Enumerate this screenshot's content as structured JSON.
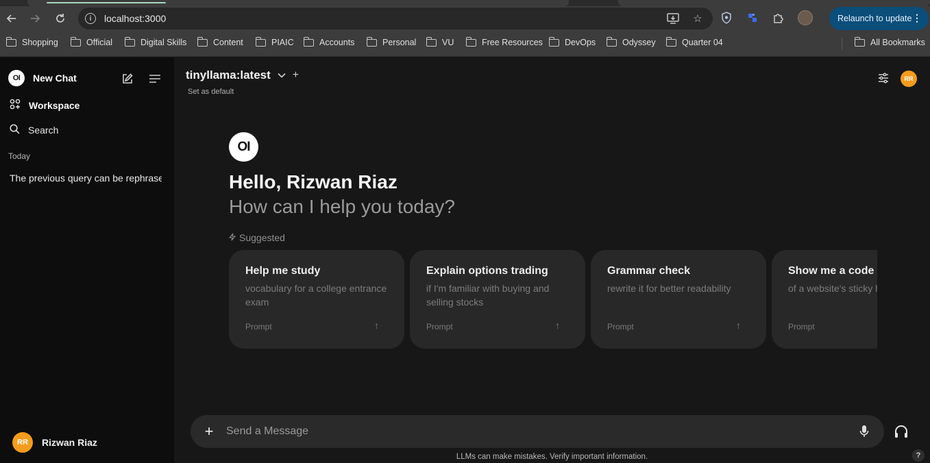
{
  "browser": {
    "url": "localhost:3000",
    "relaunch_label": "Relaunch to update",
    "bookmarks": [
      "Shopping",
      "Official",
      "Digital Skills",
      "Content",
      "PIAIC",
      "Accounts",
      "Personal",
      "VU",
      "Free Resources",
      "DevOps",
      "Odyssey",
      "Quarter 04"
    ],
    "all_bookmarks_label": "All Bookmarks",
    "relaunch_color": "#0b4e7a"
  },
  "sidebar": {
    "logo_text": "OI",
    "new_chat_label": "New Chat",
    "workspace_label": "Workspace",
    "search_label": "Search",
    "section_today": "Today",
    "history": [
      "The previous query can be rephrased"
    ],
    "user_name": "Rizwan Riaz",
    "user_initials": "RR"
  },
  "main": {
    "model_name": "tinyllama:latest",
    "set_default_label": "Set as default",
    "avatar_initials": "RR",
    "hero_logo_text": "OI",
    "greeting": "Hello, Rizwan Riaz",
    "subgreeting": "How can I help you today?",
    "suggested_label": "Suggested",
    "suggestions": [
      {
        "title": "Help me study",
        "subtitle": "vocabulary for a college entrance exam",
        "prompt_label": "Prompt"
      },
      {
        "title": "Explain options trading",
        "subtitle": "if I'm familiar with buying and selling stocks",
        "prompt_label": "Prompt"
      },
      {
        "title": "Grammar check",
        "subtitle": "rewrite it for better readability",
        "prompt_label": "Prompt"
      },
      {
        "title": "Show me a code snippet",
        "subtitle": "of a website's sticky header",
        "prompt_label": "Prompt"
      }
    ],
    "input_placeholder": "Send a Message",
    "disclaimer": "LLMs can make mistakes. Verify important information.",
    "help_label": "?",
    "accent_avatar_color": "#f39c1d"
  }
}
